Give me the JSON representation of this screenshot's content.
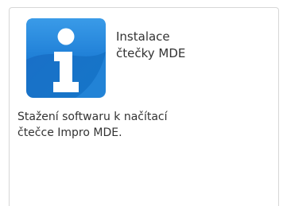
{
  "tile": {
    "icon": "info-icon",
    "title_lines": [
      "Instalace",
      "čtečky MDE"
    ],
    "description_lines": [
      "Stažení softwaru k načítací",
      "čtečce Impro MDE."
    ]
  }
}
